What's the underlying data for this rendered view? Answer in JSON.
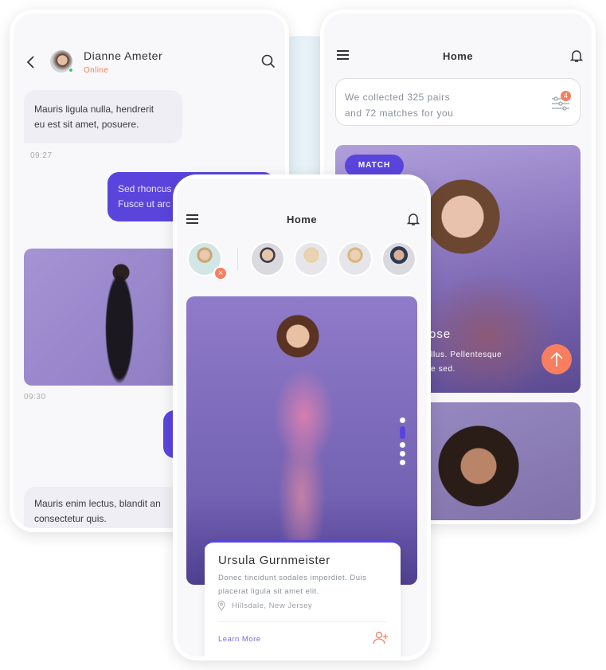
{
  "chat": {
    "contact_name": "Dianne Ameter",
    "status": "Online",
    "messages": [
      {
        "lines": [
          "Mauris ligula nulla, hendrerit",
          "eu est sit amet, posuere."
        ],
        "time": "09:27"
      },
      {
        "lines": [
          "Sed rhoncus",
          "Fusce ut arc"
        ]
      },
      {
        "time": "09:30"
      },
      {
        "lines": [
          "Mauris enim lectus, blandit an",
          "consectetur quis."
        ]
      }
    ]
  },
  "home_right": {
    "title": "Home",
    "summary_line1": "We collected 325 pairs",
    "summary_line2": "and 72 matches for you",
    "filter_badge": "4",
    "match_label": "MATCH",
    "card_name": "ose",
    "card_desc1": "ellus. Pellentesque",
    "card_desc2": "ue sed."
  },
  "home_center": {
    "title": "Home",
    "profile": {
      "name": "Ursula Gurnmeister",
      "desc1": "Donec tincidunt sodales imperdiet. Duis",
      "desc2": "placerat ligula sit amet elit.",
      "location": "Hillsdale, New Jersey",
      "learn_more": "Learn More"
    }
  },
  "colors": {
    "accent": "#5a45dc",
    "orange": "#f77e5e",
    "online": "#2ecc71"
  }
}
